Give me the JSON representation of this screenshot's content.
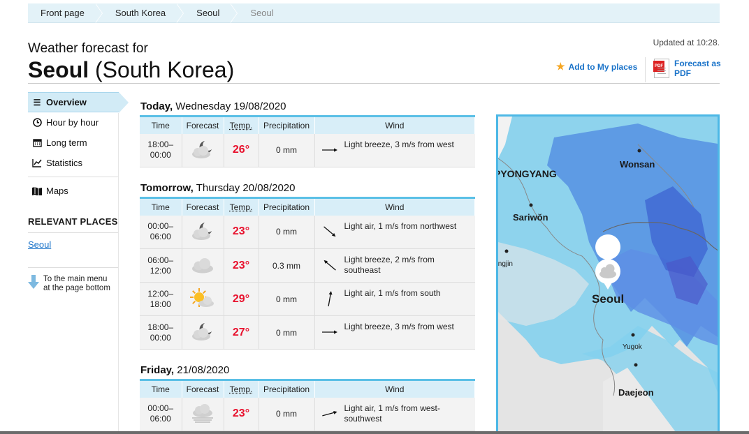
{
  "breadcrumb": [
    {
      "label": "Front page"
    },
    {
      "label": "South Korea"
    },
    {
      "label": "Seoul"
    },
    {
      "label": "Seoul"
    }
  ],
  "header": {
    "subtitle": "Weather forecast for",
    "city": "Seoul",
    "country": " (South Korea)",
    "updated": "Updated at 10:28.",
    "add_places": "Add to My places",
    "pdf_line1": "Forecast as",
    "pdf_line2": "PDF",
    "pdf_tag": "PDF"
  },
  "sidebar": {
    "items": [
      {
        "label": "Overview",
        "icon": "list-icon",
        "active": true
      },
      {
        "label": "Hour by hour",
        "icon": "clock-icon"
      },
      {
        "label": "Long term",
        "icon": "calendar-icon"
      },
      {
        "label": "Statistics",
        "icon": "chart-icon"
      },
      {
        "label": "Maps",
        "icon": "map-icon"
      }
    ],
    "relevant_heading": "RELEVANT PLACES",
    "relevant_link": "Seoul",
    "bottom_link_line1": "To the main menu",
    "bottom_link_line2": "at the page bottom"
  },
  "table_headers": {
    "time": "Time",
    "forecast": "Forecast",
    "temp": "Temp.",
    "precipitation": "Precipitation",
    "wind": "Wind"
  },
  "days": [
    {
      "bold": "Today,",
      "rest": " Wednesday 19/08/2020",
      "rows": [
        {
          "time1": "18:00–",
          "time2": "00:00",
          "icon": "cloudy-night-icon",
          "temp": "26°",
          "precip": "0 mm",
          "wind": "Light breeze, 3 m/s from west",
          "wind_line2": ""
        }
      ]
    },
    {
      "bold": "Tomorrow,",
      "rest": " Thursday 20/08/2020",
      "rows": [
        {
          "time1": "00:00–",
          "time2": "06:00",
          "icon": "cloudy-night-icon",
          "temp": "23°",
          "precip": "0 mm",
          "wind": "Light air, 1 m/s from northwest",
          "wind_line2": ""
        },
        {
          "time1": "06:00–",
          "time2": "12:00",
          "icon": "cloud-icon",
          "temp": "23°",
          "precip": "0.3 mm",
          "wind": "Light breeze, 2 m/s from southeast",
          "wind_line2": ""
        },
        {
          "time1": "12:00–",
          "time2": "18:00",
          "icon": "partly-sunny-icon",
          "temp": "29°",
          "precip": "0 mm",
          "wind": "Light air, 1 m/s from south",
          "wind_line2": ""
        },
        {
          "time1": "18:00–",
          "time2": "00:00",
          "icon": "cloudy-night-icon",
          "temp": "27°",
          "precip": "0 mm",
          "wind": "Light breeze, 3 m/s from west",
          "wind_line2": ""
        }
      ]
    },
    {
      "bold": "Friday,",
      "rest": " 21/08/2020",
      "rows": [
        {
          "time1": "00:00–",
          "time2": "06:00",
          "icon": "fog-icon",
          "temp": "23°",
          "precip": "0 mm",
          "wind": "Light air, 1 m/s from west-",
          "wind_line2": "southwest"
        }
      ]
    }
  ],
  "map": {
    "labels": {
      "pyongyang": "PYONGYANG",
      "wonsan": "Wonsan",
      "sariwon": "Sariwŏn",
      "ongjin": "Ongjin",
      "seoul": "Seoul",
      "yugok": "Yugok",
      "daejeon": "Daejeon"
    }
  },
  "colors": {
    "accent": "#5bc0e6",
    "link": "#1a73c9",
    "temp_warm": "#e8112d"
  }
}
